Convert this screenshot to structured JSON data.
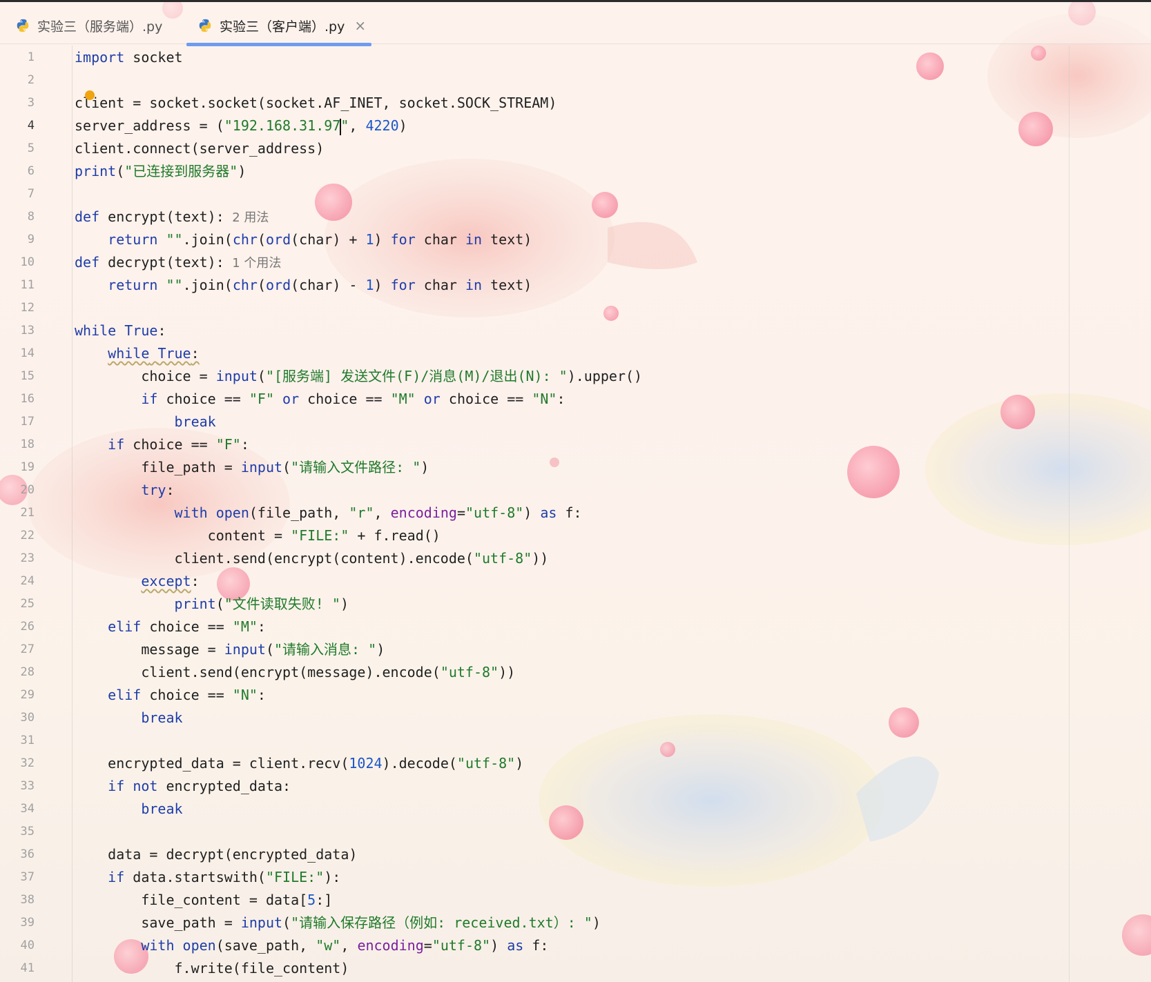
{
  "tabs": [
    {
      "label": "实验三（服务端）.py",
      "active": false
    },
    {
      "label": "实验三（客户端）.py",
      "active": true
    }
  ],
  "tab_close_icon": "close-icon",
  "file_icon": "python-icon",
  "current_line": 4,
  "colors": {
    "keyword": "#1e3da8",
    "string": "#1f7a2a",
    "number": "#1a55c9",
    "kwarg": "#7a1fa0",
    "active_tab_underline": "#6e9bf0",
    "hint_bulb": "#f0a410"
  },
  "code_lines": [
    "import socket",
    "",
    "client = socket.socket(socket.AF_INET, socket.SOCK_STREAM)",
    "server_address = (\"192.168.31.97\", 4220)",
    "client.connect(server_address)",
    "print(\"已连接到服务器\")",
    "",
    "def encrypt(text):",
    "    return \"\".join(chr(ord(char) + 1) for char in text)",
    "def decrypt(text):",
    "    return \"\".join(chr(ord(char) - 1) for char in text)",
    "",
    "while True:",
    "    while True:",
    "        choice = input(\"[服务端] 发送文件(F)/消息(M)/退出(N): \").upper()",
    "        if choice == \"F\" or choice == \"M\" or choice == \"N\":",
    "            break",
    "    if choice == \"F\":",
    "        file_path = input(\"请输入文件路径: \")",
    "        try:",
    "            with open(file_path, \"r\", encoding=\"utf-8\") as f:",
    "                content = \"FILE:\" + f.read()",
    "            client.send(encrypt(content).encode(\"utf-8\"))",
    "        except:",
    "            print(\"文件读取失败! \")",
    "    elif choice == \"M\":",
    "        message = input(\"请输入消息: \")",
    "        client.send(encrypt(message).encode(\"utf-8\"))",
    "    elif choice == \"N\":",
    "        break",
    "",
    "    encrypted_data = client.recv(1024).decode(\"utf-8\")",
    "    if not encrypted_data:",
    "        break",
    "",
    "    data = decrypt(encrypted_data)",
    "    if data.startswith(\"FILE:\"):",
    "        file_content = data[5:]",
    "        save_path = input(\"请输入保存路径（例如: received.txt）: \")",
    "        with open(save_path, \"w\", encoding=\"utf-8\") as f:",
    "            f.write(file_content)"
  ],
  "inlay_hints": {
    "8": "2 用法",
    "10": "1 个用法"
  }
}
